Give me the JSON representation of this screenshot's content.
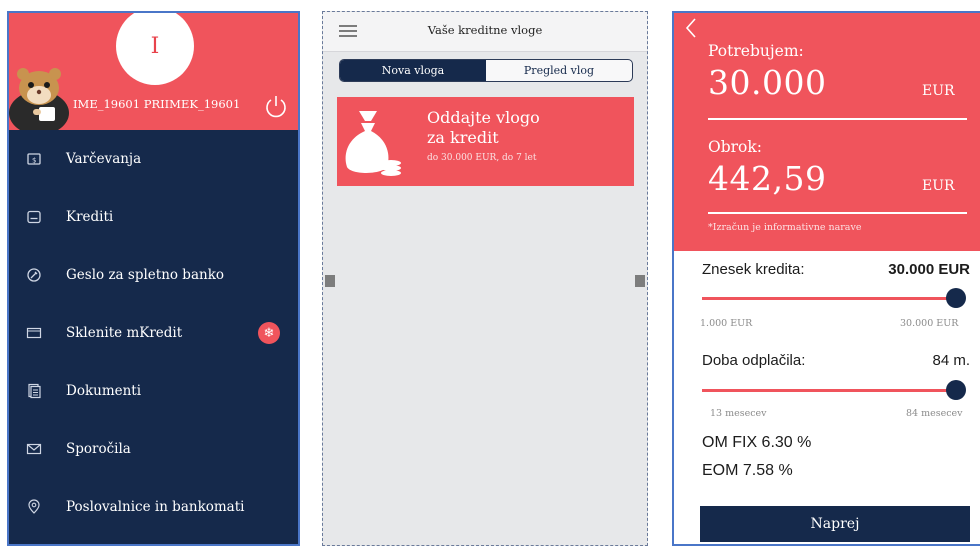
{
  "menu_screen": {
    "avatar_initial": "I",
    "user_name": "IME_19601 PRIIMEK_19601",
    "items": [
      {
        "label": "Varčevanja",
        "icon": "savings-icon"
      },
      {
        "label": "Krediti",
        "icon": "credit-icon"
      },
      {
        "label": "Geslo za spletno banko",
        "icon": "password-icon"
      },
      {
        "label": "Sklenite mKredit",
        "icon": "mcredit-icon",
        "badge": "❄"
      },
      {
        "label": "Dokumenti",
        "icon": "documents-icon"
      },
      {
        "label": "Sporočila",
        "icon": "envelope-icon"
      },
      {
        "label": "Poslovalnice in bankomati",
        "icon": "location-icon"
      }
    ]
  },
  "requests_screen": {
    "title": "Vaše kreditne vloge",
    "tabs": {
      "new": "Nova vloga",
      "overview": "Pregled vlog"
    },
    "card": {
      "line1": "Oddajte vlogo",
      "line2": "za kredit",
      "sub": "do 30.000 EUR, do 7 let"
    }
  },
  "calculator_screen": {
    "need_label": "Potrebujem:",
    "need_value": "30.000",
    "need_currency": "EUR",
    "installment_label": "Obrok:",
    "installment_value": "442,59",
    "installment_currency": "EUR",
    "note": "*Izračun je informativne narave",
    "amount": {
      "label": "Znesek kredita:",
      "value": "30.000 EUR",
      "min": "1.000 EUR",
      "max": "30.000 EUR",
      "fraction": 1.0
    },
    "term": {
      "label": "Doba odplačila:",
      "value": "84 m.",
      "min": "13 mesecev",
      "max": "84 mesecev",
      "fraction": 1.0
    },
    "om": "OM FIX 6.30 %",
    "eom": "EOM 7.58 %",
    "next_button": "Naprej"
  },
  "colors": {
    "accent": "#f0545c",
    "navy": "#15294b"
  }
}
